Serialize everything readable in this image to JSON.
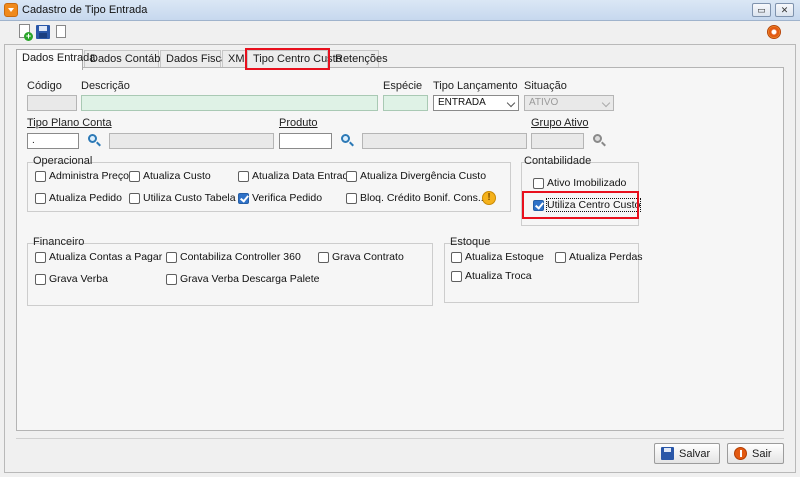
{
  "window": {
    "title": "Cadastro de Tipo Entrada"
  },
  "titlebar_buttons": {
    "restore": "▭",
    "close": "✕"
  },
  "toolbar": {
    "icons": [
      "new-record-icon",
      "save-icon",
      "copy-icon",
      "help-icon"
    ]
  },
  "tabs": [
    {
      "label": "Dados Entrada"
    },
    {
      "label": "Dados Contábeis"
    },
    {
      "label": "Dados Fiscais"
    },
    {
      "label": "XML"
    },
    {
      "label": "Tipo Centro Custo"
    },
    {
      "label": "Retenções"
    }
  ],
  "active_tab": "Dados Entrada",
  "highlighted_tab": "Tipo Centro Custo",
  "form": {
    "codigo": {
      "label": "Código",
      "value": ""
    },
    "descricao": {
      "label": "Descrição",
      "value": ""
    },
    "especie": {
      "label": "Espécie",
      "value": ""
    },
    "tipo_lancamento": {
      "label": "Tipo Lançamento",
      "value": "ENTRADA"
    },
    "situacao": {
      "label": "Situação",
      "value": "ATIVO"
    },
    "tipo_plano_conta": {
      "label": "Tipo Plano Conta",
      "value": "."
    },
    "produto": {
      "label": "Produto",
      "value": ""
    },
    "grupo_ativo": {
      "label": "Grupo Ativo",
      "value": ""
    }
  },
  "operacional": {
    "title": "Operacional",
    "items": [
      {
        "label": "Administra Preço",
        "checked": false
      },
      {
        "label": "Atualiza Custo",
        "checked": false
      },
      {
        "label": "Atualiza Data Entrada",
        "checked": false
      },
      {
        "label": "Atualiza Divergência Custo",
        "checked": false
      },
      {
        "label": "Atualiza Pedido",
        "checked": false
      },
      {
        "label": "Utiliza Custo Tabela",
        "checked": false
      },
      {
        "label": "Verifica Pedido",
        "checked": true
      },
      {
        "label": "Bloq. Crédito Bonif. Cons...",
        "checked": false
      }
    ],
    "info_glyph": "!"
  },
  "contabilidade": {
    "title": "Contabilidade",
    "items": [
      {
        "label": "Ativo Imobilizado",
        "checked": false
      },
      {
        "label": "Utiliza Centro Custo",
        "checked": true
      }
    ]
  },
  "financeiro": {
    "title": "Financeiro",
    "items": [
      {
        "label": "Atualiza Contas a Pagar",
        "checked": false
      },
      {
        "label": "Contabiliza Controller 360",
        "checked": false
      },
      {
        "label": "Grava Contrato",
        "checked": false
      },
      {
        "label": "Grava Verba",
        "checked": false
      },
      {
        "label": "Grava Verba Descarga Palete",
        "checked": false
      }
    ]
  },
  "estoque": {
    "title": "Estoque",
    "items": [
      {
        "label": "Atualiza Estoque",
        "checked": false
      },
      {
        "label": "Atualiza Perdas",
        "checked": false
      },
      {
        "label": "Atualiza Troca",
        "checked": false
      }
    ]
  },
  "buttons": {
    "salvar": "Salvar",
    "sair": "Sair"
  },
  "colors": {
    "highlight": "#e8101d",
    "checkbox_checked": "#2f72c8",
    "field_green": "#dff2e6"
  }
}
